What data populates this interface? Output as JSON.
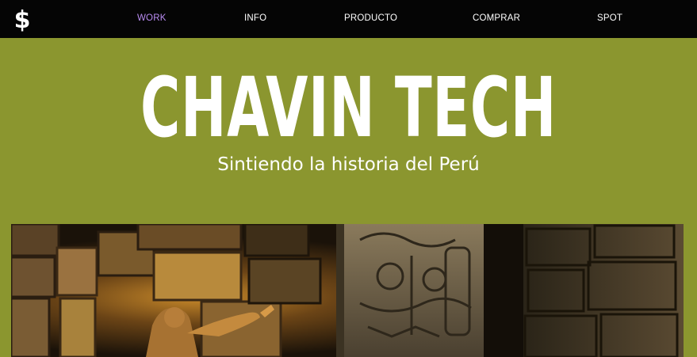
{
  "nav": {
    "logo_icon": "dollar-sign-icon",
    "links": [
      {
        "label": "WORK",
        "active": true
      },
      {
        "label": "INFO",
        "active": false
      },
      {
        "label": "PRODUCTO",
        "active": false
      },
      {
        "label": "COMPRAR",
        "active": false
      },
      {
        "label": "SPOT",
        "active": false
      }
    ]
  },
  "hero": {
    "title": "CHAVIN TECH",
    "subtitle": "Sintiendo la historia del Perú"
  },
  "image": {
    "subject": "chavin-temple-scene"
  },
  "colors": {
    "nav_bg": "#050505",
    "page_bg": "#8b962f",
    "active_link": "#b98cf2",
    "text": "#ffffff"
  }
}
